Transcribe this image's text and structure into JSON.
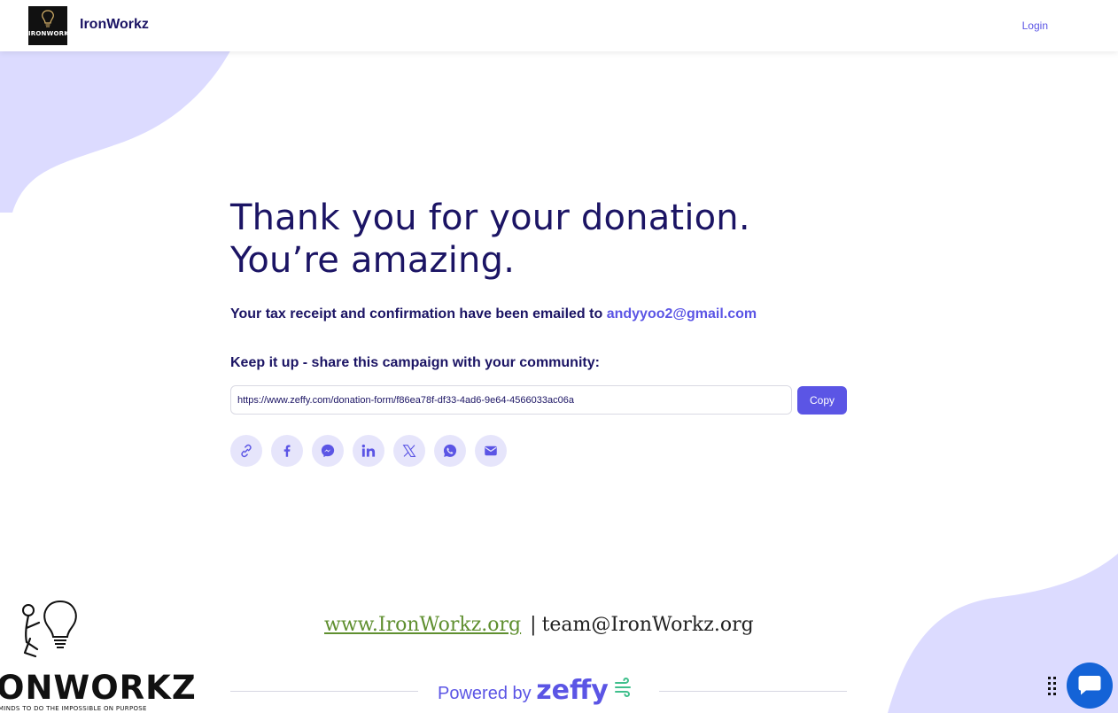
{
  "header": {
    "brand_name": "IronWorkz",
    "logo_text": "IRONWORKZ",
    "login_label": "Login"
  },
  "main": {
    "headline_line1": "Thank you for your donation.",
    "headline_line2": "You’re amazing.",
    "receipt_text": "Your tax receipt and confirmation have been emailed to",
    "receipt_email": "andyyoo2@gmail.com",
    "share_heading": "Keep it up - share this campaign with your community:",
    "share_url": "https://www.zeffy.com/donation-form/f86ea78f-df33-4ad6-9e64-4566033ac06a",
    "copy_label": "Copy",
    "social_icons": [
      "link-icon",
      "facebook-icon",
      "messenger-icon",
      "linkedin-icon",
      "x-icon",
      "whatsapp-icon",
      "email-icon"
    ]
  },
  "footer": {
    "website": "www.IronWorkz.org",
    "separator": "|",
    "email": "team@IronWorkz.org",
    "logo_wordmark": "ONWORKZ",
    "logo_tagline": "MINDS TO DO THE IMPOSSIBLE ON PURPOSE",
    "powered_prefix": "Powered by",
    "powered_brand": "zeffy"
  },
  "colors": {
    "accent": "#5b55e5",
    "navy": "#1b1464",
    "blob": "#dcdbff",
    "social_bg": "#e6e5fb",
    "chat": "#1463d7",
    "link_green": "#5f8f2f"
  }
}
